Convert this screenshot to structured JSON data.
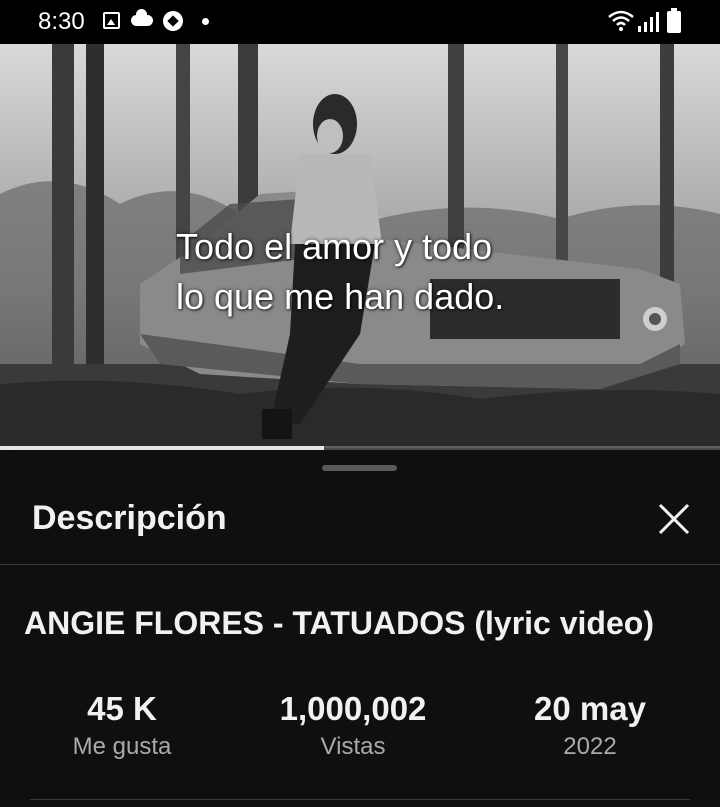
{
  "status_bar": {
    "time": "8:30"
  },
  "video": {
    "lyrics_line1": "Todo el amor y todo",
    "lyrics_line2": "lo que me han dado.",
    "progress_fraction": 0.45
  },
  "sheet": {
    "title": "Descripción",
    "video_title": "ANGIE FLORES - TATUADOS (lyric video)",
    "stats": {
      "likes_value": "45 K",
      "likes_label": "Me gusta",
      "views_value": "1,000,002",
      "views_label": "Vistas",
      "date_value": "20 may",
      "date_label": "2022"
    }
  },
  "colors": {
    "background": "#0f0f0f",
    "text_primary": "#f1f1f1",
    "text_secondary": "#aaaaaa",
    "divider": "#3a3a3a"
  },
  "icons": {
    "status": [
      "image-icon",
      "cloud-icon",
      "soccer-ball-icon",
      "notification-dot-icon",
      "wifi-icon",
      "signal-icon",
      "battery-icon"
    ],
    "close": "close-icon"
  }
}
